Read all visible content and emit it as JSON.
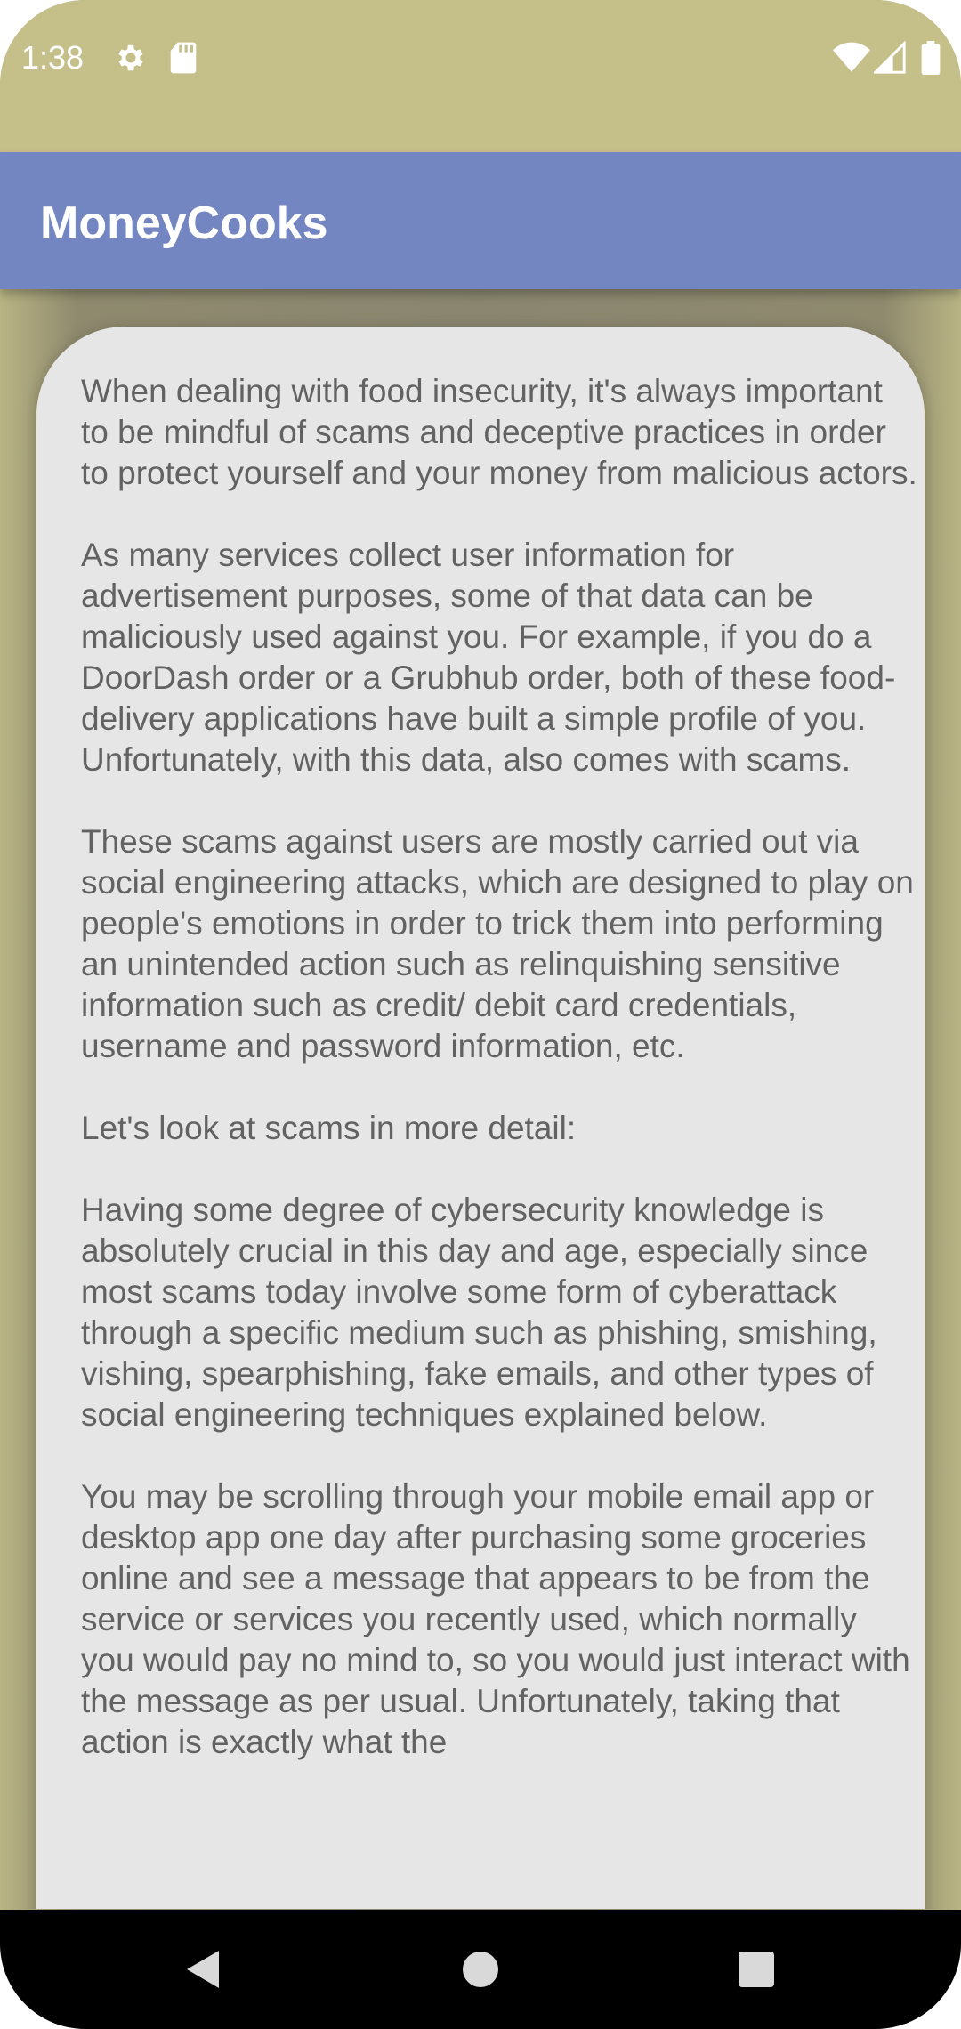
{
  "status_bar": {
    "time": "1:38",
    "left_icons": [
      "gear-icon",
      "sd-card-icon"
    ],
    "right_icons": [
      "wifi-icon",
      "cell-signal-icon",
      "battery-icon"
    ]
  },
  "app_bar": {
    "title": "MoneyCooks",
    "color": "#7486c1"
  },
  "article": {
    "paragraphs": [
      "When dealing with food insecurity, it's always important to be mindful of scams and deceptive practices in order to protect yourself and your money from malicious actors.",
      "As many services collect user information for advertisement purposes, some of that data can be maliciously used against you. For example, if you do a DoorDash order or a Grubhub order, both of these food-delivery applications have built a simple profile of you. Unfortunately, with this data, also comes with scams.",
      "These scams against users are mostly carried out via social engineering attacks, which are designed to play on people's emotions in order to trick them into performing an unintended action such as relinquishing sensitive information such as credit/ debit card credentials, username and password information, etc.",
      "Let's look at scams in more detail:",
      "Having some degree of cybersecurity knowledge is absolutely crucial in this day and age, especially since most scams today involve some form of cyberattack through a specific medium such as phishing, smishing, vishing, spearphishing, fake emails, and other types of social engineering techniques explained below.",
      "You may be scrolling through your mobile email app or desktop app one day after purchasing some groceries online and see a message that appears to be from the service or services you recently used, which normally you would pay no mind to, so you would just interact with the message as per usual. Unfortunately, taking that action is exactly what the"
    ]
  },
  "nav_bar": {
    "icons": [
      "back-icon",
      "home-icon",
      "recents-icon"
    ]
  }
}
